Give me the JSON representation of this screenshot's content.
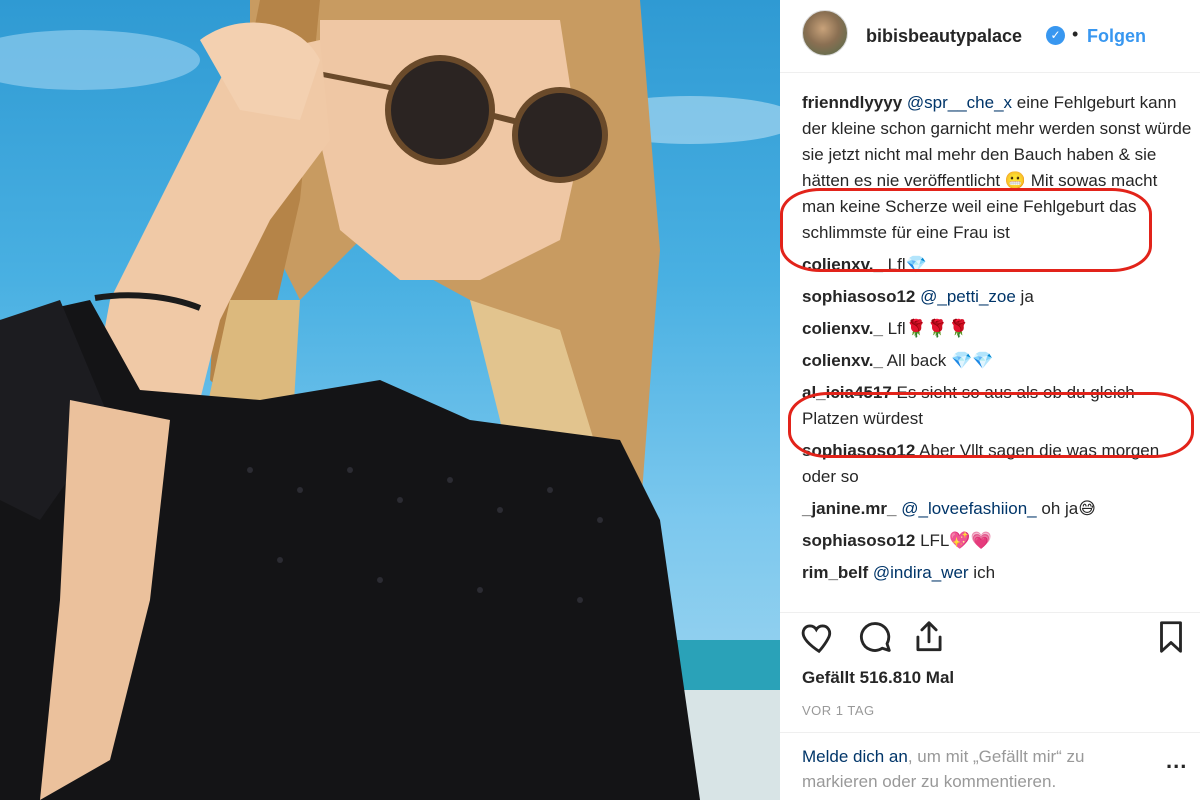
{
  "post": {
    "username": "bibisbeautypalace",
    "verified_glyph": "✓",
    "separator": "•",
    "follow_label": "Folgen"
  },
  "comments": [
    {
      "user": "frienndlyyyy",
      "mention": "@spr__che_x",
      "text": " eine Fehlgeburt kann der kleine schon garnicht mehr werden sonst würde sie jetzt nicht mal mehr den Bauch haben & sie hätten es nie veröffentlicht 😬 Mit sowas macht man keine Scherze weil eine Fehlgeburt das schlimmste für eine Frau ist"
    },
    {
      "user": "colienxv._",
      "mention": "",
      "text": " Lfl💎"
    },
    {
      "user": "sophiasoso12",
      "mention": "@_petti_zoe",
      "text": " ja"
    },
    {
      "user": "colienxv._",
      "mention": "",
      "text": " Lfl🌹🌹🌹"
    },
    {
      "user": "colienxv._",
      "mention": "",
      "text": " All back 💎💎"
    },
    {
      "user": "al_icia4517",
      "mention": "",
      "text": " Es sieht so aus als ob du gleich Platzen würdest"
    },
    {
      "user": "sophiasoso12",
      "mention": "",
      "text": " Aber Vllt sagen die was morgen oder so"
    },
    {
      "user": "_janine.mr_",
      "mention": "@_loveefashiion_",
      "text": " oh ja😅"
    },
    {
      "user": "sophiasoso12",
      "mention": "",
      "text": " LFL💖💗"
    },
    {
      "user": "rim_belf",
      "mention": "@indira_wer",
      "text": " ich"
    }
  ],
  "icons": {
    "like": "heart-icon",
    "comment": "comment-icon",
    "share": "share-icon",
    "save": "bookmark-icon",
    "options": "more-options-icon"
  },
  "likes_text": "Gefällt 516.810 Mal",
  "timestamp": "VOR 1 TAG",
  "login": {
    "link_text": "Melde dich an",
    "rest_text": ", um mit „Gefällt mir“ zu markieren oder zu kommentieren."
  },
  "more_label": "...",
  "colors": {
    "accent_blue": "#3897f0",
    "mention_blue": "#003569",
    "annotation_red": "#e2231a",
    "meta_grey": "#999999"
  }
}
